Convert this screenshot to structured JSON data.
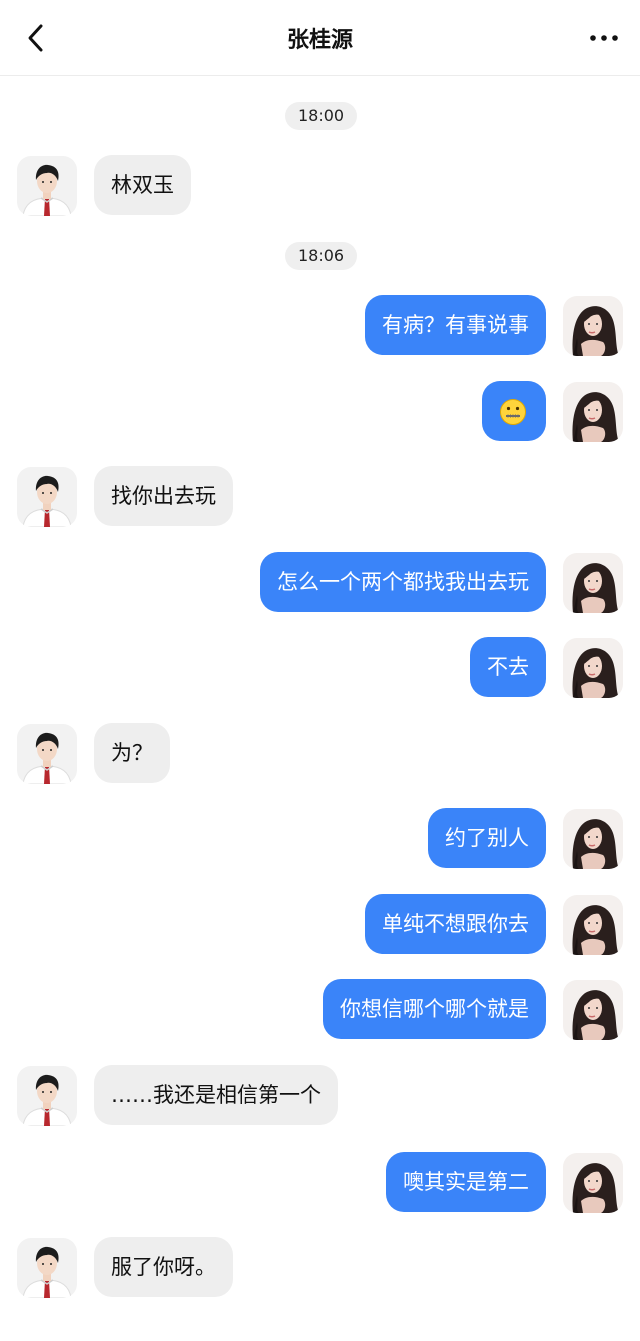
{
  "header": {
    "title": "张桂源",
    "back_icon": "chevron-left-icon",
    "more_icon": "more-horizontal-icon"
  },
  "colors": {
    "outgoing_bubble": "#3a84f9",
    "incoming_bubble": "#eeeeee"
  },
  "timestamps": [
    "18:00",
    "18:06"
  ],
  "messages": [
    {
      "side": "in",
      "text": "林双玉"
    },
    {
      "side": "out",
      "text": "有病？有事说事"
    },
    {
      "side": "out",
      "text": "",
      "emoji": "zipper-mouth-face-emoji"
    },
    {
      "side": "in",
      "text": "找你出去玩"
    },
    {
      "side": "out",
      "text": "怎么一个两个都找我出去玩"
    },
    {
      "side": "out",
      "text": "不去"
    },
    {
      "side": "in",
      "text": "为？"
    },
    {
      "side": "out",
      "text": "约了别人"
    },
    {
      "side": "out",
      "text": "单纯不想跟你去"
    },
    {
      "side": "out",
      "text": "你想信哪个哪个就是"
    },
    {
      "side": "in",
      "text": "……我还是相信第一个"
    },
    {
      "side": "out",
      "text": "噢其实是第二"
    },
    {
      "side": "in",
      "text": "服了你呀。"
    }
  ]
}
